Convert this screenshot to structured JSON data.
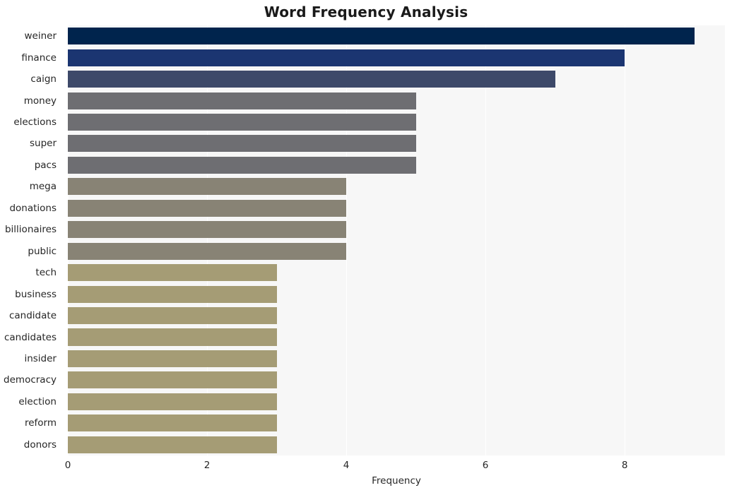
{
  "chart_data": {
    "type": "bar",
    "orientation": "horizontal",
    "title": "Word Frequency Analysis",
    "xlabel": "Frequency",
    "ylabel": "",
    "categories": [
      "weiner",
      "finance",
      "caign",
      "money",
      "elections",
      "super",
      "pacs",
      "mega",
      "donations",
      "billionaires",
      "public",
      "tech",
      "business",
      "candidate",
      "candidates",
      "insider",
      "democracy",
      "election",
      "reform",
      "donors"
    ],
    "values": [
      9,
      8,
      7,
      5,
      5,
      5,
      5,
      4,
      4,
      4,
      4,
      3,
      3,
      3,
      3,
      3,
      3,
      3,
      3,
      3
    ],
    "bar_colors": [
      "#00244d",
      "#1b3571",
      "#3d4969",
      "#6e6e72",
      "#6e6e72",
      "#6e6e72",
      "#6e6e72",
      "#888375",
      "#888375",
      "#888375",
      "#888375",
      "#a59c75",
      "#a59c75",
      "#a59c75",
      "#a59c75",
      "#a59c75",
      "#a59c75",
      "#a59c75",
      "#a59c75",
      "#a59c75"
    ],
    "xlim": [
      0,
      9.44
    ],
    "xticks": [
      0,
      2,
      4,
      6,
      8
    ],
    "xtick_labels": [
      "0",
      "2",
      "4",
      "6",
      "8"
    ],
    "grid": true,
    "gridline_color": "#ffffff",
    "plot_background": "#f7f7f7",
    "figure_background": "#ffffff",
    "legend": null
  }
}
